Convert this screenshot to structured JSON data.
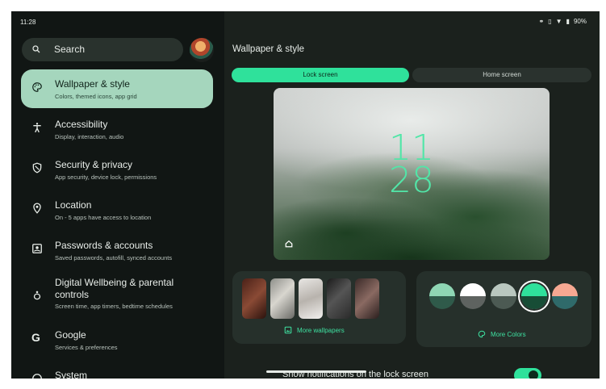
{
  "status_bar": {
    "time": "11:28",
    "battery": "90%",
    "icons": [
      "link-icon",
      "vibrate-icon",
      "wifi-icon",
      "battery-icon"
    ]
  },
  "sidebar": {
    "search_label": "Search",
    "items": [
      {
        "title": "Wallpaper & style",
        "subtitle": "Colors, themed icons, app grid",
        "icon": "palette-icon",
        "active": true
      },
      {
        "title": "Accessibility",
        "subtitle": "Display, interaction, audio",
        "icon": "accessibility-icon"
      },
      {
        "title": "Security & privacy",
        "subtitle": "App security, device lock, permissions",
        "icon": "shield-icon"
      },
      {
        "title": "Location",
        "subtitle": "On - 5 apps have access to location",
        "icon": "location-pin-icon"
      },
      {
        "title": "Passwords & accounts",
        "subtitle": "Saved passwords, autofill, synced accounts",
        "icon": "account-box-icon"
      },
      {
        "title": "Digital Wellbeing & parental controls",
        "subtitle": "Screen time, app timers, bedtime schedules",
        "icon": "wellbeing-icon"
      },
      {
        "title": "Google",
        "subtitle": "Services & preferences",
        "icon": "google-icon"
      },
      {
        "title": "System",
        "subtitle": "",
        "icon": "info-icon"
      }
    ]
  },
  "main": {
    "title": "Wallpaper & style",
    "tabs": [
      {
        "label": "Lock screen",
        "selected": true
      },
      {
        "label": "Home screen",
        "selected": false
      }
    ],
    "preview": {
      "clock_hour": "11",
      "clock_minute": "28"
    },
    "wallpapers_link": "More wallpapers",
    "colors_link": "More Colors",
    "lock_notifications_label": "Show notifications on the lock screen",
    "lock_notifications_enabled": true
  },
  "colors": {
    "accent": "#2fe19b",
    "active_item_bg": "#a5d6bd",
    "clock": "#52e6a8",
    "swatches": [
      {
        "top": "#8fd6b4",
        "bottom": "#2f5a4a"
      },
      {
        "top": "#ffffff",
        "bottom": "#5e6360"
      },
      {
        "top": "#b9c7bf",
        "bottom": "#4c5a53"
      },
      {
        "top": "#2fe19b",
        "bottom": "#174d36"
      },
      {
        "top": "#f6a892",
        "bottom": "#2f6a6a"
      }
    ]
  }
}
